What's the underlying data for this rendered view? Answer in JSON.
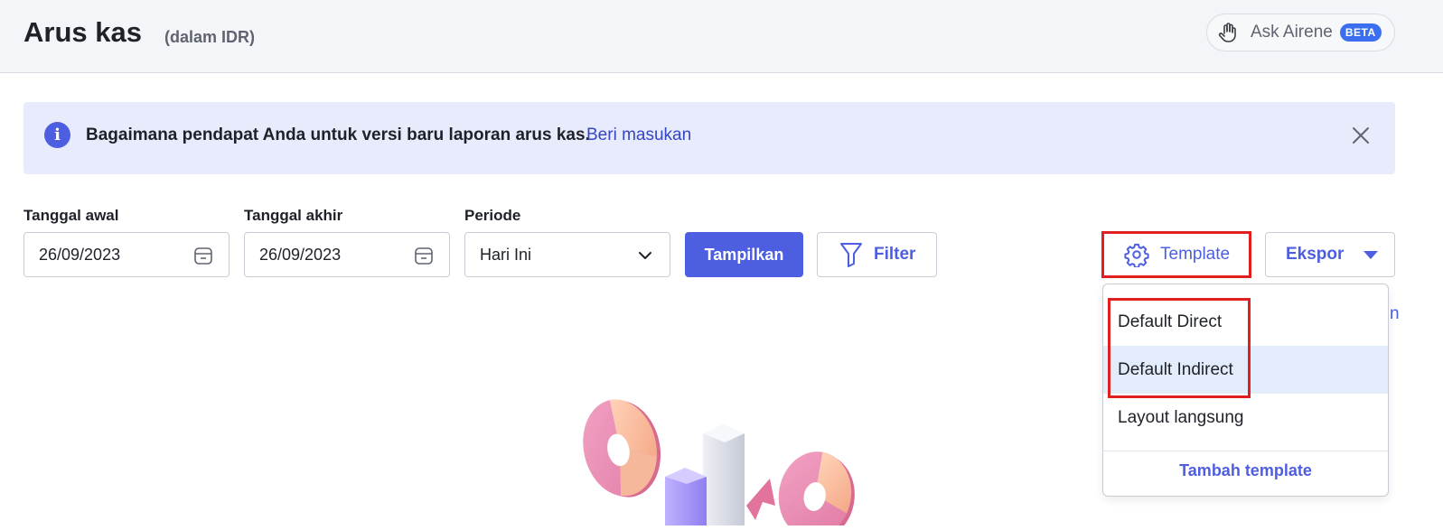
{
  "header": {
    "title": "Arus kas",
    "subtitle": "(dalam IDR)",
    "ask_label": "Ask Airene",
    "beta_badge": "BETA"
  },
  "banner": {
    "text": "Bagaimana pendapat Anda untuk versi baru laporan arus kas.",
    "link": "Beri masukan"
  },
  "filters": {
    "start_date_label": "Tanggal awal",
    "start_date_value": "26/09/2023",
    "end_date_label": "Tanggal akhir",
    "end_date_value": "26/09/2023",
    "period_label": "Periode",
    "period_value": "Hari Ini"
  },
  "toolbar": {
    "show_label": "Tampilkan",
    "filter_label": "Filter",
    "template_label": "Template",
    "export_label": "Ekspor"
  },
  "template_menu": {
    "items": [
      {
        "label": "Default Direct"
      },
      {
        "label": "Default Indirect",
        "highlighted": true
      },
      {
        "label": "Layout langsung"
      }
    ],
    "add_label": "Tambah template"
  },
  "colors": {
    "accent": "#4d5ee0",
    "highlight_border": "#e02020",
    "banner_bg": "#e8ebfb",
    "active_item_bg": "#e3ecfb"
  }
}
